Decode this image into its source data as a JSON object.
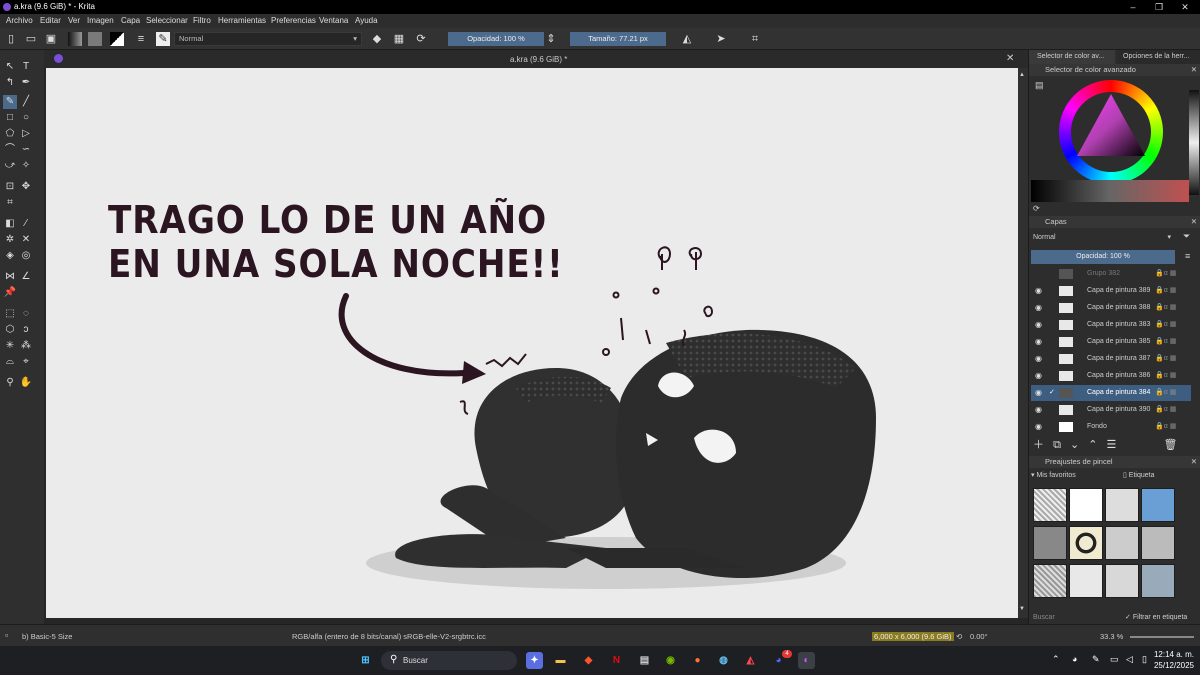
{
  "window": {
    "title": "a.kra (9.6 GiB) * - Krita"
  },
  "menu": [
    "Archivo",
    "Editar",
    "Ver",
    "Imagen",
    "Capa",
    "Seleccionar",
    "Filtro",
    "Herramientas",
    "Preferencias",
    "Ventana",
    "Ayuda"
  ],
  "toolbar": {
    "blend_mode": "Normal",
    "opacity_label": "Opacidad: 100 %",
    "size_label": "Tamaño: 77.21 px"
  },
  "document": {
    "tab_title": "a.kra (9.6 GiB) *"
  },
  "canvas_text": {
    "line1": "TRAGO LO DE UN AÑO",
    "line2": "EN UNA SOLA NOCHE!!"
  },
  "right_panel": {
    "dock_tabs": [
      "Selector de color av...",
      "Opciones de la herr..."
    ],
    "color_selector_title": "Selector de color avanzado",
    "layers_title": "Capas",
    "layers_blend": "Normal",
    "layers_opacity": "Opacidad:  100 %",
    "layers": [
      {
        "name": "Grupo 382",
        "active": false
      },
      {
        "name": "Capa de pintura 389",
        "active": false
      },
      {
        "name": "Capa de pintura 388",
        "active": false
      },
      {
        "name": "Capa de pintura 383",
        "active": false
      },
      {
        "name": "Capa de pintura 385",
        "active": false
      },
      {
        "name": "Capa de pintura 387",
        "active": false
      },
      {
        "name": "Capa de pintura 386",
        "active": false
      },
      {
        "name": "Capa de pintura 384",
        "active": true
      },
      {
        "name": "Capa de pintura 390",
        "active": false
      },
      {
        "name": "Fondo",
        "active": false
      }
    ],
    "presets_title": "Preajustes de pincel",
    "presets_favorites": "Mis favoritos",
    "presets_tag": "Etiqueta",
    "presets_search_placeholder": "Buscar",
    "presets_filter": "Filtrar en etiqueta"
  },
  "statusbar": {
    "brush": "b) Basic-5 Size",
    "colorspace": "RGB/alfa (entero de 8 bits/canal)  sRGB-elle-V2-srgbtrc.icc",
    "dimensions": "6,000 x 6,000 (9.6 GiB)",
    "rotation": "0.00°",
    "zoom": "33.3 %"
  },
  "taskbar": {
    "search_placeholder": "Buscar",
    "time": "12:14 a. m.",
    "date": "25/12/2025",
    "badge": "4"
  },
  "colors": {
    "accent": "#4b6a8c",
    "active_layer": "#3d5e80",
    "canvas": "#ebebeb",
    "ink": "#2a1520"
  }
}
